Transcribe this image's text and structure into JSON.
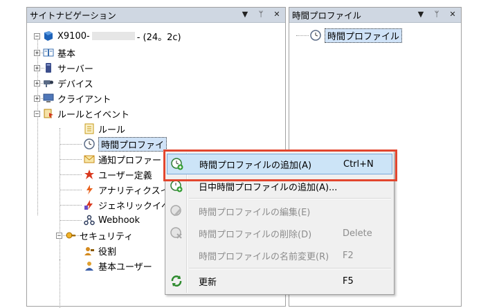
{
  "left_panel": {
    "title": "サイトナビゲーション",
    "tree": {
      "root_label_prefix": "X9100-",
      "root_label_suffix": "- (24。2c)",
      "items": {
        "basic": "基本",
        "servers": "サーバー",
        "devices": "デバイス",
        "clients": "クライアント",
        "rules_events": "ルールとイベント",
        "rules": "ルール",
        "time_profiles": "時間プロファイ",
        "notification_profiles": "通知プロファー",
        "user_defined": "ユーザー定義",
        "analytics": "アナリティクスイ",
        "generic_events": "ジェネリックイベ",
        "webhook": "Webhook",
        "security": "セキュリティ",
        "roles": "役割",
        "basic_users": "基本ユーザー"
      }
    }
  },
  "right_panel": {
    "title": "時間プロファイル",
    "items": [
      "時間プロファイル"
    ]
  },
  "panel_controls": {
    "dropdown": "▼",
    "pin": "ᛘ",
    "close": "✕"
  },
  "context_menu": {
    "items": [
      {
        "label": "時間プロファイルの追加(A)",
        "shortcut": "Ctrl+N",
        "icon": "add-time-profile-icon",
        "enabled": true,
        "highlighted": true
      },
      {
        "label": "日中時間プロファイルの追加(A)...",
        "shortcut": "",
        "icon": "add-daytime-profile-icon",
        "enabled": true
      },
      {
        "label": "時間プロファイルの編集(E)",
        "shortcut": "",
        "icon": "edit-profile-icon",
        "enabled": false
      },
      {
        "label": "時間プロファイルの削除(D)",
        "shortcut": "Delete",
        "icon": "delete-profile-icon",
        "enabled": false
      },
      {
        "label": "時間プロファイルの名前変更(R)",
        "shortcut": "F2",
        "icon": "",
        "enabled": false
      },
      {
        "label": "更新",
        "shortcut": "F5",
        "icon": "refresh-icon",
        "enabled": true
      }
    ]
  },
  "colors": {
    "highlight_frame": "#e2462e",
    "menu_highlight": "#cce4f7",
    "header_bg": "#cfd7e2"
  }
}
